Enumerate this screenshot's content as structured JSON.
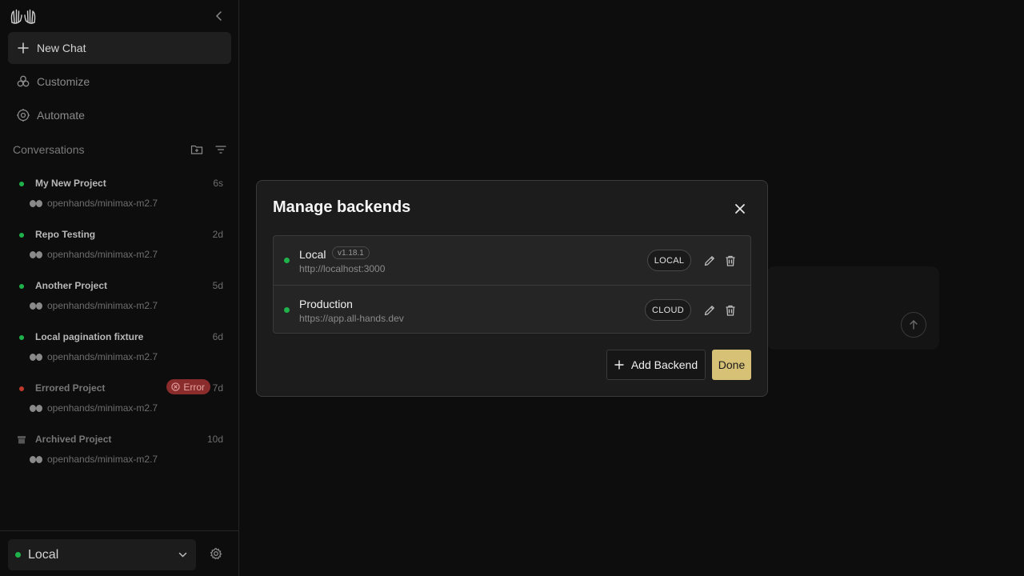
{
  "sidebar": {
    "new_chat_label": "New Chat",
    "nav": [
      {
        "label": "Customize",
        "icon": "customize-icon"
      },
      {
        "label": "Automate",
        "icon": "automate-icon"
      }
    ],
    "conversations_title": "Conversations",
    "conversations": [
      {
        "name": "My New Project",
        "time": "6s",
        "model": "openhands/minimax-m2.7",
        "status": "running",
        "status_color": "#1fb24a"
      },
      {
        "name": "Repo Testing",
        "time": "2d",
        "model": "openhands/minimax-m2.7",
        "status": "running",
        "status_color": "#1fb24a"
      },
      {
        "name": "Another Project",
        "time": "5d",
        "model": "openhands/minimax-m2.7",
        "status": "running",
        "status_color": "#1fb24a"
      },
      {
        "name": "Local pagination fixture",
        "time": "6d",
        "model": "openhands/minimax-m2.7",
        "status": "running",
        "status_color": "#1fb24a"
      },
      {
        "name": "Errored Project",
        "time": "7d",
        "model": "openhands/minimax-m2.7",
        "status": "error",
        "status_color": "#c0392b",
        "badge": "Error"
      },
      {
        "name": "Archived Project",
        "time": "10d",
        "model": "openhands/minimax-m2.7",
        "status": "archived",
        "status_color": "#555555"
      }
    ],
    "backend_selector": "Local"
  },
  "modal": {
    "title": "Manage backends",
    "backends": [
      {
        "name": "Local",
        "version": "v1.18.1",
        "url": "http://localhost:3000",
        "tag": "LOCAL",
        "status_color": "#1fb24a"
      },
      {
        "name": "Production",
        "version": "",
        "url": "https://app.all-hands.dev",
        "tag": "CLOUD",
        "status_color": "#1fb24a"
      }
    ],
    "add_label": "Add Backend",
    "done_label": "Done"
  },
  "colors": {
    "accent": "#d6c177",
    "online": "#1fb24a",
    "error": "#8b2c2c"
  }
}
